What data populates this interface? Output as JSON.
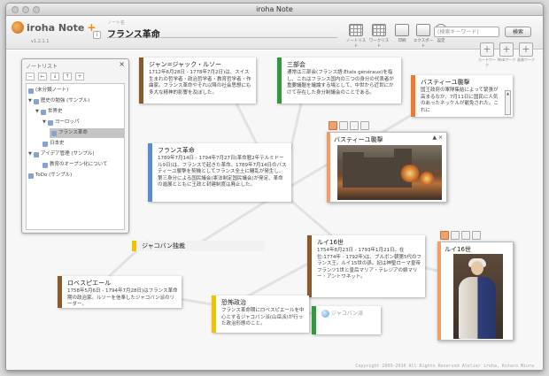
{
  "window": {
    "title": "iroha Note"
  },
  "app": {
    "logo_text": "iroha Note",
    "logo_plus": "+",
    "version": "v1.2.1.1"
  },
  "note_header": {
    "name_label": "ノート名",
    "name": "フランス革命"
  },
  "toolbar": {
    "buttons": [
      {
        "label": "ノートリスト",
        "icon": "note-list-icon"
      },
      {
        "label": "ワークリスト",
        "icon": "work-list-icon"
      },
      {
        "label": "印刷",
        "icon": "print-icon"
      },
      {
        "label": "エクスポート",
        "icon": "export-icon"
      },
      {
        "label": "設定",
        "icon": "gear-icon"
      }
    ],
    "search_placeholder": "(検索キーワード)",
    "search_button": "検索",
    "add_buttons": [
      {
        "label": "カードワーク",
        "icon": "add-card-icon"
      },
      {
        "label": "Webワーク",
        "icon": "add-web-icon"
      },
      {
        "label": "画像ワーク",
        "icon": "add-image-icon"
      }
    ]
  },
  "note_list": {
    "title": "ノートリスト",
    "close": "×",
    "tools": [
      "−",
      "←",
      "↓",
      "↑",
      "+"
    ],
    "items": [
      {
        "label": "(未分類ノート)",
        "level": 0,
        "arrow": ""
      },
      {
        "label": "歴史の勉強 (サンプル)",
        "level": 0,
        "arrow": "▼"
      },
      {
        "label": "世界史",
        "level": 1,
        "arrow": "▼"
      },
      {
        "label": "ヨーロッパ",
        "level": 2,
        "arrow": "▼"
      },
      {
        "label": "フランス革命",
        "level": 3,
        "arrow": "",
        "selected": true
      },
      {
        "label": "日本史",
        "level": 1,
        "arrow": ""
      },
      {
        "label": "アイデア管理 (サンプル)",
        "level": 0,
        "arrow": "▼"
      },
      {
        "label": "教育のオープン化について",
        "level": 1,
        "arrow": ""
      },
      {
        "label": "ToDo (サンプル)",
        "level": 0,
        "arrow": ""
      }
    ]
  },
  "cards": {
    "rousseau": {
      "title": "ジャン=ジャック・ルソー",
      "body": "1712年6月28日 - 1778年7月2日)は、スイス生まれの哲学者・政治哲学者・教育哲学者・作曲家。フランス革命やそれ以降の社会思想にも多大な精神的影響を及ぼした。",
      "color": "#8b5a2b"
    },
    "sanbukai": {
      "title": "三部会",
      "body": "通常は三部会(フランス語:États généraux)を指し、これはフランス国内の三つの身分の代表者が重要議題を議論する場として、中世から近世にかけて存在した身分制議会のことである。",
      "color": "#2f9a3a"
    },
    "bastille_text": {
      "title": "バスティーユ襲撃",
      "body": "国王政府の軍隊集結によって緊張が高まるなか、7月11日に国民に人気のあったネッケルが罷免された。これに",
      "color": "#f07a2a"
    },
    "revolution": {
      "title": "フランス革命",
      "body": "1789年7月14日 - 1794年7月27日(革命暦2年テルミドール9日)は、フランスで起きた革命。1789年7月14日のバスティーユ襲撃を契機としてフランス全土に騒乱が発生し、第三身分による国民議会(憲法制定国民議会)が発足、革命の進展とともに王政と封建制度は廃止した。",
      "color": "#5b8bd0"
    },
    "jacobin_club": {
      "title": "ジャコバン独裁",
      "color": "#f2c200"
    },
    "louis16_text": {
      "title": "ルイ16世",
      "body": "1754年8月23日 - 1793年1月21日。在位:1774年 - 1792年)は、ブルボン朝第5代のフランス王。ルイ15世の孫。妃は神聖ローマ皇帝フランツ1世と皇后マリア・テレジアの娘マリー・アントワネット。",
      "color": "#8b5a2b"
    },
    "robespierre": {
      "title": "ロベスピエール",
      "body": "1758年5月6日 - 1794年7月28日)はフランス革命期の政治家。ルソーを信奉したジャコバン派のリーダー。",
      "color": "#8b5a2b"
    },
    "terror": {
      "title": "恐怖政治",
      "body": "フランス革命期にロベスピエールを中心とするジャコバン派(山岳派)が行った政治形態のこと。",
      "color": "#f2c200"
    },
    "jacobin": {
      "title": "ジャコバン派",
      "color": "#2f9a3a"
    }
  },
  "image_cards": {
    "bastille": {
      "title": "バスティーユ襲撃",
      "controls": "▲ ×",
      "color": "#f49b68"
    },
    "louis16": {
      "title": "ルイ16世",
      "color": "#f49b68"
    }
  },
  "footer": {
    "copyright": "Copyright 2009-2010 All Rights Reserved Atelier iroha, Kotaro Miura"
  }
}
